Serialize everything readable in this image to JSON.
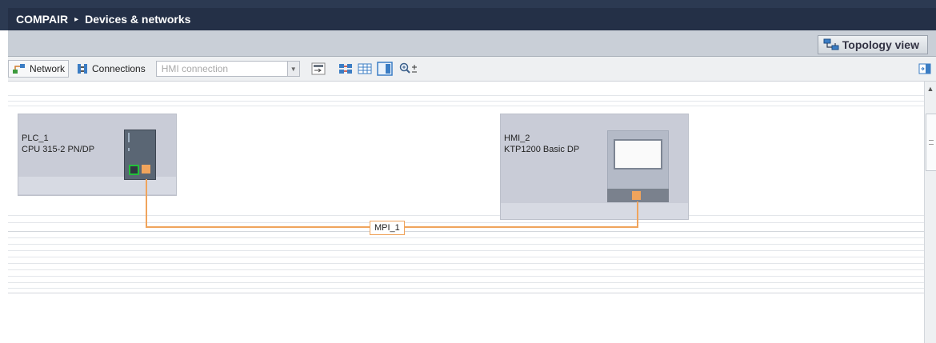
{
  "breadcrumb": {
    "project": "COMPAIR",
    "separator": "▸",
    "current": "Devices & networks"
  },
  "view_tabs": {
    "topology_label": "Topology view"
  },
  "toolbar": {
    "network_label": "Network",
    "connections_label": "Connections",
    "connection_select": {
      "value": "HMI connection"
    },
    "icons": [
      "show-names-icon",
      "assign-icon",
      "table-icon",
      "overview-icon",
      "zoom-icon"
    ]
  },
  "devices": [
    {
      "name": "PLC_1",
      "type": "CPU 315-2 PN/DP"
    },
    {
      "name": "HMI_2",
      "type": "KTP1200 Basic DP"
    }
  ],
  "network": {
    "label": "MPI_1",
    "color": "#f0a45c"
  },
  "colors": {
    "title_bar": "#243047",
    "device_bg": "#c9ccd7",
    "mpi_wire": "#f0a45c"
  }
}
